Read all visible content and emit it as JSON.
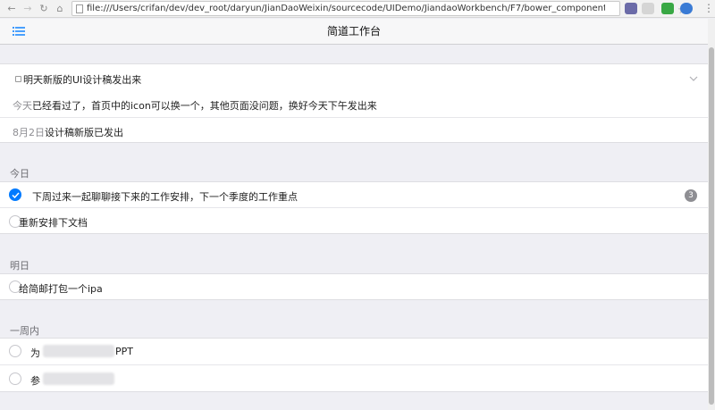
{
  "browser": {
    "url": "file:///Users/crifan/dev/dev_root/daryun/JianDaoWeixin/sourcecode/UIDemo/JiandaoWorkbench/F7/bower_components/Framew..."
  },
  "navbar": {
    "title": "简道工作台"
  },
  "featured": {
    "title": "明天新版的UI设计稿发出来",
    "comments": [
      {
        "label": "今天",
        "text": "已经看过了，首页中的icon可以换一个，其他页面没问题，换好今天下午发出来"
      },
      {
        "label": "8月2日",
        "text": "设计稿新版已发出"
      }
    ]
  },
  "sections": [
    {
      "label": "今日",
      "items": [
        {
          "text": "下周过来一起聊聊接下来的工作安排，下一个季度的工作重点",
          "checked": true,
          "badge": "3"
        },
        {
          "text": "重新安排下文档",
          "checked": false,
          "badge": ""
        }
      ]
    },
    {
      "label": "明日",
      "items": [
        {
          "text": "给简邮打包一个ipa",
          "checked": false,
          "badge": ""
        }
      ]
    },
    {
      "label": "一周内",
      "items": [
        {
          "text": "为",
          "suffix": "PPT",
          "checked": false,
          "badge": ""
        },
        {
          "text": "参",
          "suffix": "",
          "checked": false,
          "badge": ""
        }
      ]
    }
  ],
  "colors": {
    "accent": "#007aff",
    "badge": "#8e8e93",
    "background": "#efeff4"
  }
}
